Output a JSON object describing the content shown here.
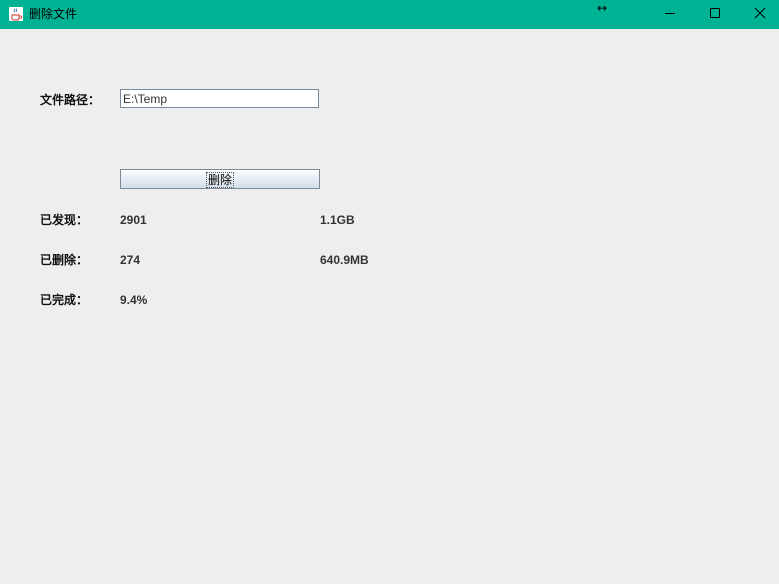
{
  "window": {
    "title": "删除文件",
    "titlebar_color": "#00b294",
    "app_icon": "java-coffee-cup-icon",
    "resize_indicator": "↔",
    "controls": {
      "minimize_icon": "minimize-icon",
      "maximize_icon": "maximize-icon",
      "close_icon": "close-icon"
    }
  },
  "form": {
    "path_label": "文件路径：",
    "path_value": "E:\\Temp",
    "delete_button_label": "删除"
  },
  "stats": {
    "found_label": "已发现：",
    "found_count": "2901",
    "found_size": "1.1GB",
    "deleted_label": "已删除：",
    "deleted_count": "274",
    "deleted_size": "640.9MB",
    "completed_label": "已完成：",
    "completed_percent": "9.4%"
  }
}
